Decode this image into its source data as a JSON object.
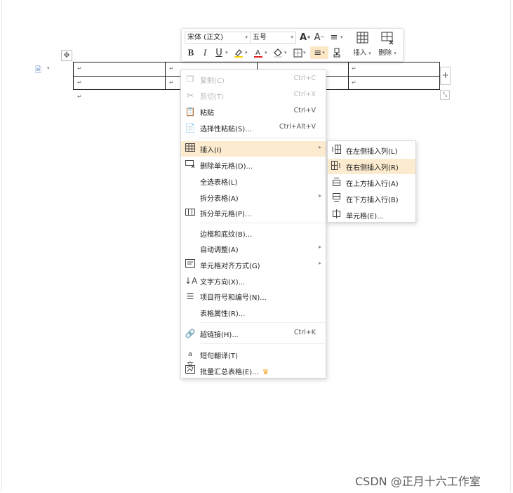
{
  "toolbar": {
    "font_family": "宋体 (正文)",
    "font_size": "五号",
    "insert_label": "插入",
    "delete_label": "删除"
  },
  "context_menu": {
    "items": [
      {
        "label": "复制(C)",
        "shortcut": "Ctrl+C",
        "icon": "copy-icon"
      },
      {
        "label": "剪切(T)",
        "shortcut": "Ctrl+X",
        "icon": "cut-icon"
      },
      {
        "label": "粘贴",
        "shortcut": "Ctrl+V",
        "icon": "paste-icon"
      },
      {
        "label": "选择性粘贴(S)...",
        "shortcut": "Ctrl+Alt+V",
        "icon": "paste-special-icon"
      },
      {
        "label": "插入(I)",
        "shortcut": "",
        "icon": "insert-table-icon"
      },
      {
        "label": "删除单元格(D)...",
        "shortcut": "",
        "icon": "delete-cell-icon"
      },
      {
        "label": "全选表格(L)",
        "shortcut": "",
        "icon": ""
      },
      {
        "label": "拆分表格(A)",
        "shortcut": "",
        "icon": ""
      },
      {
        "label": "拆分单元格(P)...",
        "shortcut": "",
        "icon": "split-cell-icon"
      },
      {
        "label": "边框和底纹(B)...",
        "shortcut": "",
        "icon": ""
      },
      {
        "label": "自动调整(A)",
        "shortcut": "",
        "icon": ""
      },
      {
        "label": "单元格对齐方式(G)",
        "shortcut": "",
        "icon": "cell-align-icon"
      },
      {
        "label": "文字方向(X)...",
        "shortcut": "",
        "icon": "text-direction-icon"
      },
      {
        "label": "项目符号和编号(N)...",
        "shortcut": "",
        "icon": "bullet-list-icon"
      },
      {
        "label": "表格属性(R)...",
        "shortcut": "",
        "icon": ""
      },
      {
        "label": "超链接(H)...",
        "shortcut": "Ctrl+K",
        "icon": "hyperlink-icon"
      },
      {
        "label": "短句翻译(T)",
        "shortcut": "",
        "icon": "translate-icon"
      },
      {
        "label": "批量汇总表格(E)...",
        "shortcut": "",
        "icon": "batch-summary-icon"
      }
    ]
  },
  "submenu": {
    "items": [
      {
        "label": "在左侧插入列(L)",
        "icon": "insert-col-left-icon"
      },
      {
        "label": "在右侧插入列(R)",
        "icon": "insert-col-right-icon"
      },
      {
        "label": "在上方插入行(A)",
        "icon": "insert-row-above-icon"
      },
      {
        "label": "在下方插入行(B)",
        "icon": "insert-row-below-icon"
      },
      {
        "label": "单元格(E)...",
        "icon": "insert-cell-icon"
      }
    ]
  },
  "table": {
    "cell_mark": "↵"
  },
  "watermark": "CSDN @正月十六工作室",
  "colors": {
    "highlight": "#fdebcf",
    "crown": "#f2a623"
  }
}
